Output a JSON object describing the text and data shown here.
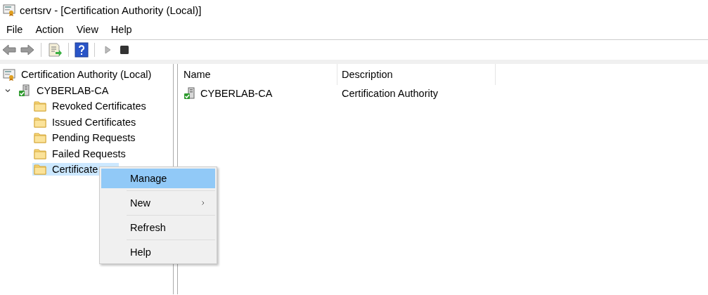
{
  "window": {
    "title": "certsrv - [Certification Authority (Local)]"
  },
  "menu_bar": [
    "File",
    "Action",
    "View",
    "Help"
  ],
  "tree": {
    "label": "Certification Authority (Local)",
    "selected": false,
    "children": [
      {
        "label": "CYBERLAB-CA",
        "selected": false,
        "expanded": true,
        "children": [
          {
            "label": "Revoked Certificates",
            "selected": false
          },
          {
            "label": "Issued Certificates",
            "selected": false
          },
          {
            "label": "Pending Requests",
            "selected": false
          },
          {
            "label": "Failed Requests",
            "selected": false
          },
          {
            "label": "Certificate",
            "selected": true
          }
        ]
      }
    ]
  },
  "list": {
    "columns": [
      "Name",
      "Description"
    ],
    "rows": [
      {
        "name": "CYBERLAB-CA",
        "description": "Certification Authority"
      }
    ]
  },
  "context_menu": {
    "items": [
      {
        "label": "Manage",
        "selected": true,
        "submenu": false
      },
      {
        "label": "New",
        "selected": false,
        "submenu": true
      },
      {
        "label": "Refresh",
        "selected": false,
        "submenu": false
      },
      {
        "label": "Help",
        "selected": false,
        "submenu": false
      }
    ]
  }
}
